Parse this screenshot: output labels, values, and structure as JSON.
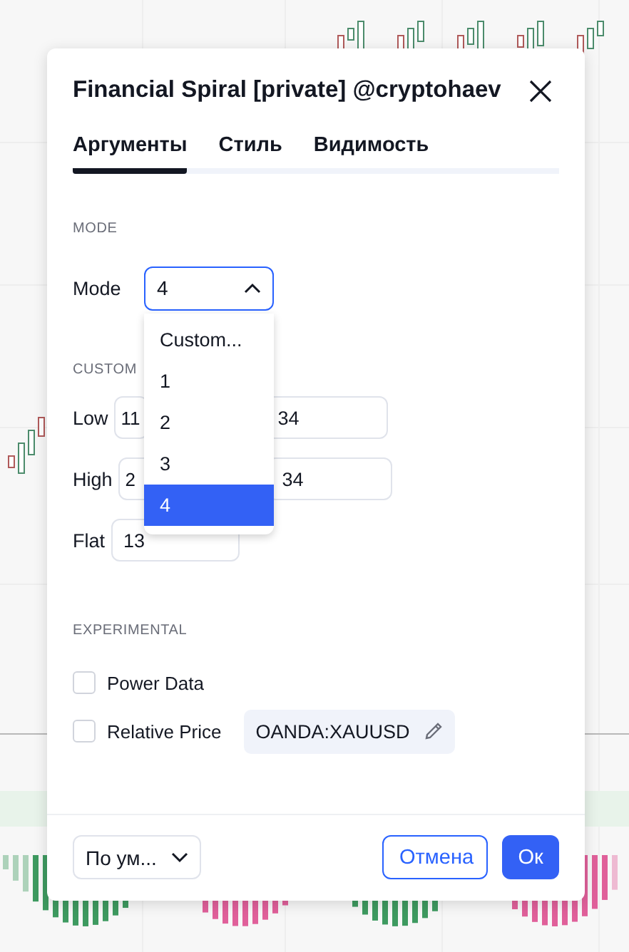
{
  "dialog": {
    "title": "Financial Spiral [private] @cryptohaev"
  },
  "tabs": [
    {
      "label": "Аргументы",
      "selected": true
    },
    {
      "label": "Стиль",
      "selected": false
    },
    {
      "label": "Видимость",
      "selected": false
    }
  ],
  "mode_section": {
    "heading": "MODE",
    "label": "Mode",
    "value": "4",
    "expanded": true,
    "options": [
      {
        "label": "Custom...",
        "selected": false
      },
      {
        "label": "1",
        "selected": false
      },
      {
        "label": "2",
        "selected": false
      },
      {
        "label": "3",
        "selected": false
      },
      {
        "label": "4",
        "selected": true
      }
    ]
  },
  "custom_section": {
    "heading": "CUSTOM",
    "rows": [
      {
        "label": "Low",
        "values": [
          "11",
          "34"
        ]
      },
      {
        "label": "High",
        "values": [
          "2",
          "34"
        ]
      },
      {
        "label": "Flat",
        "values": [
          "13"
        ]
      }
    ]
  },
  "experimental_section": {
    "heading": "EXPERIMENTAL",
    "options": [
      {
        "label": "Power Data",
        "checked": false
      },
      {
        "label": "Relative Price",
        "checked": false,
        "symbol": "OANDA:XAUUSD"
      }
    ]
  },
  "footer": {
    "preset": "По ум...",
    "buttons": [
      {
        "label": "Отмена",
        "kind": "secondary"
      },
      {
        "label": "Ок",
        "kind": "primary"
      }
    ]
  }
}
